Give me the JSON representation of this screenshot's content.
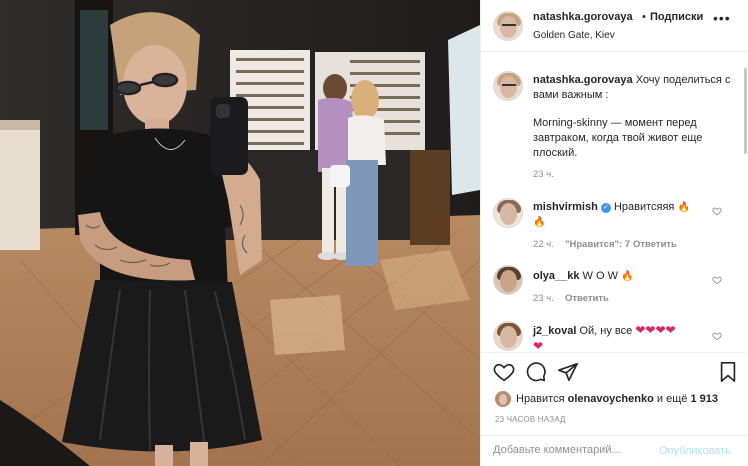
{
  "post": {
    "username": "natashka.gorovaya",
    "dot": "•",
    "follow_label": "Подписки",
    "location": "Golden Gate, Kiev",
    "more_icon": "more-horizontal-icon"
  },
  "caption": {
    "username": "natashka.gorovaya",
    "text_head": "Хочу поделиться с вами важным :",
    "text_body": "Morning-skinny — момент перед завтраком, когда твой живот еще плоский.",
    "time": "23 ч."
  },
  "comments": [
    {
      "username": "mishvirmish",
      "verified": true,
      "text": "Нравитсяяя",
      "time": "22 ч.",
      "likes": "\"Нравится\": 7",
      "reply": "Ответить"
    },
    {
      "username": "olya__kk",
      "text": "W O W",
      "time": "23 ч.",
      "reply": "Ответить"
    },
    {
      "username": "j2_koval",
      "text": "Ой, ну все"
    }
  ],
  "actions": {
    "like_icon": "heart-icon",
    "comment_icon": "comment-icon",
    "share_icon": "paper-plane-icon",
    "save_icon": "bookmark-icon",
    "likes_prefix": "Нравится",
    "likes_user": "olenavoychenko",
    "likes_suffix": "и ещё",
    "likes_count": "1 913",
    "time_ago": "23 ЧАСОВ НАЗАД"
  },
  "add_comment": {
    "placeholder": "Добавьте комментарий...",
    "publish_label": "Опубликовать"
  },
  "colors": {
    "link_disabled": "#b2dffc",
    "verified": "#3897f0",
    "meta": "#8e8e8e"
  }
}
